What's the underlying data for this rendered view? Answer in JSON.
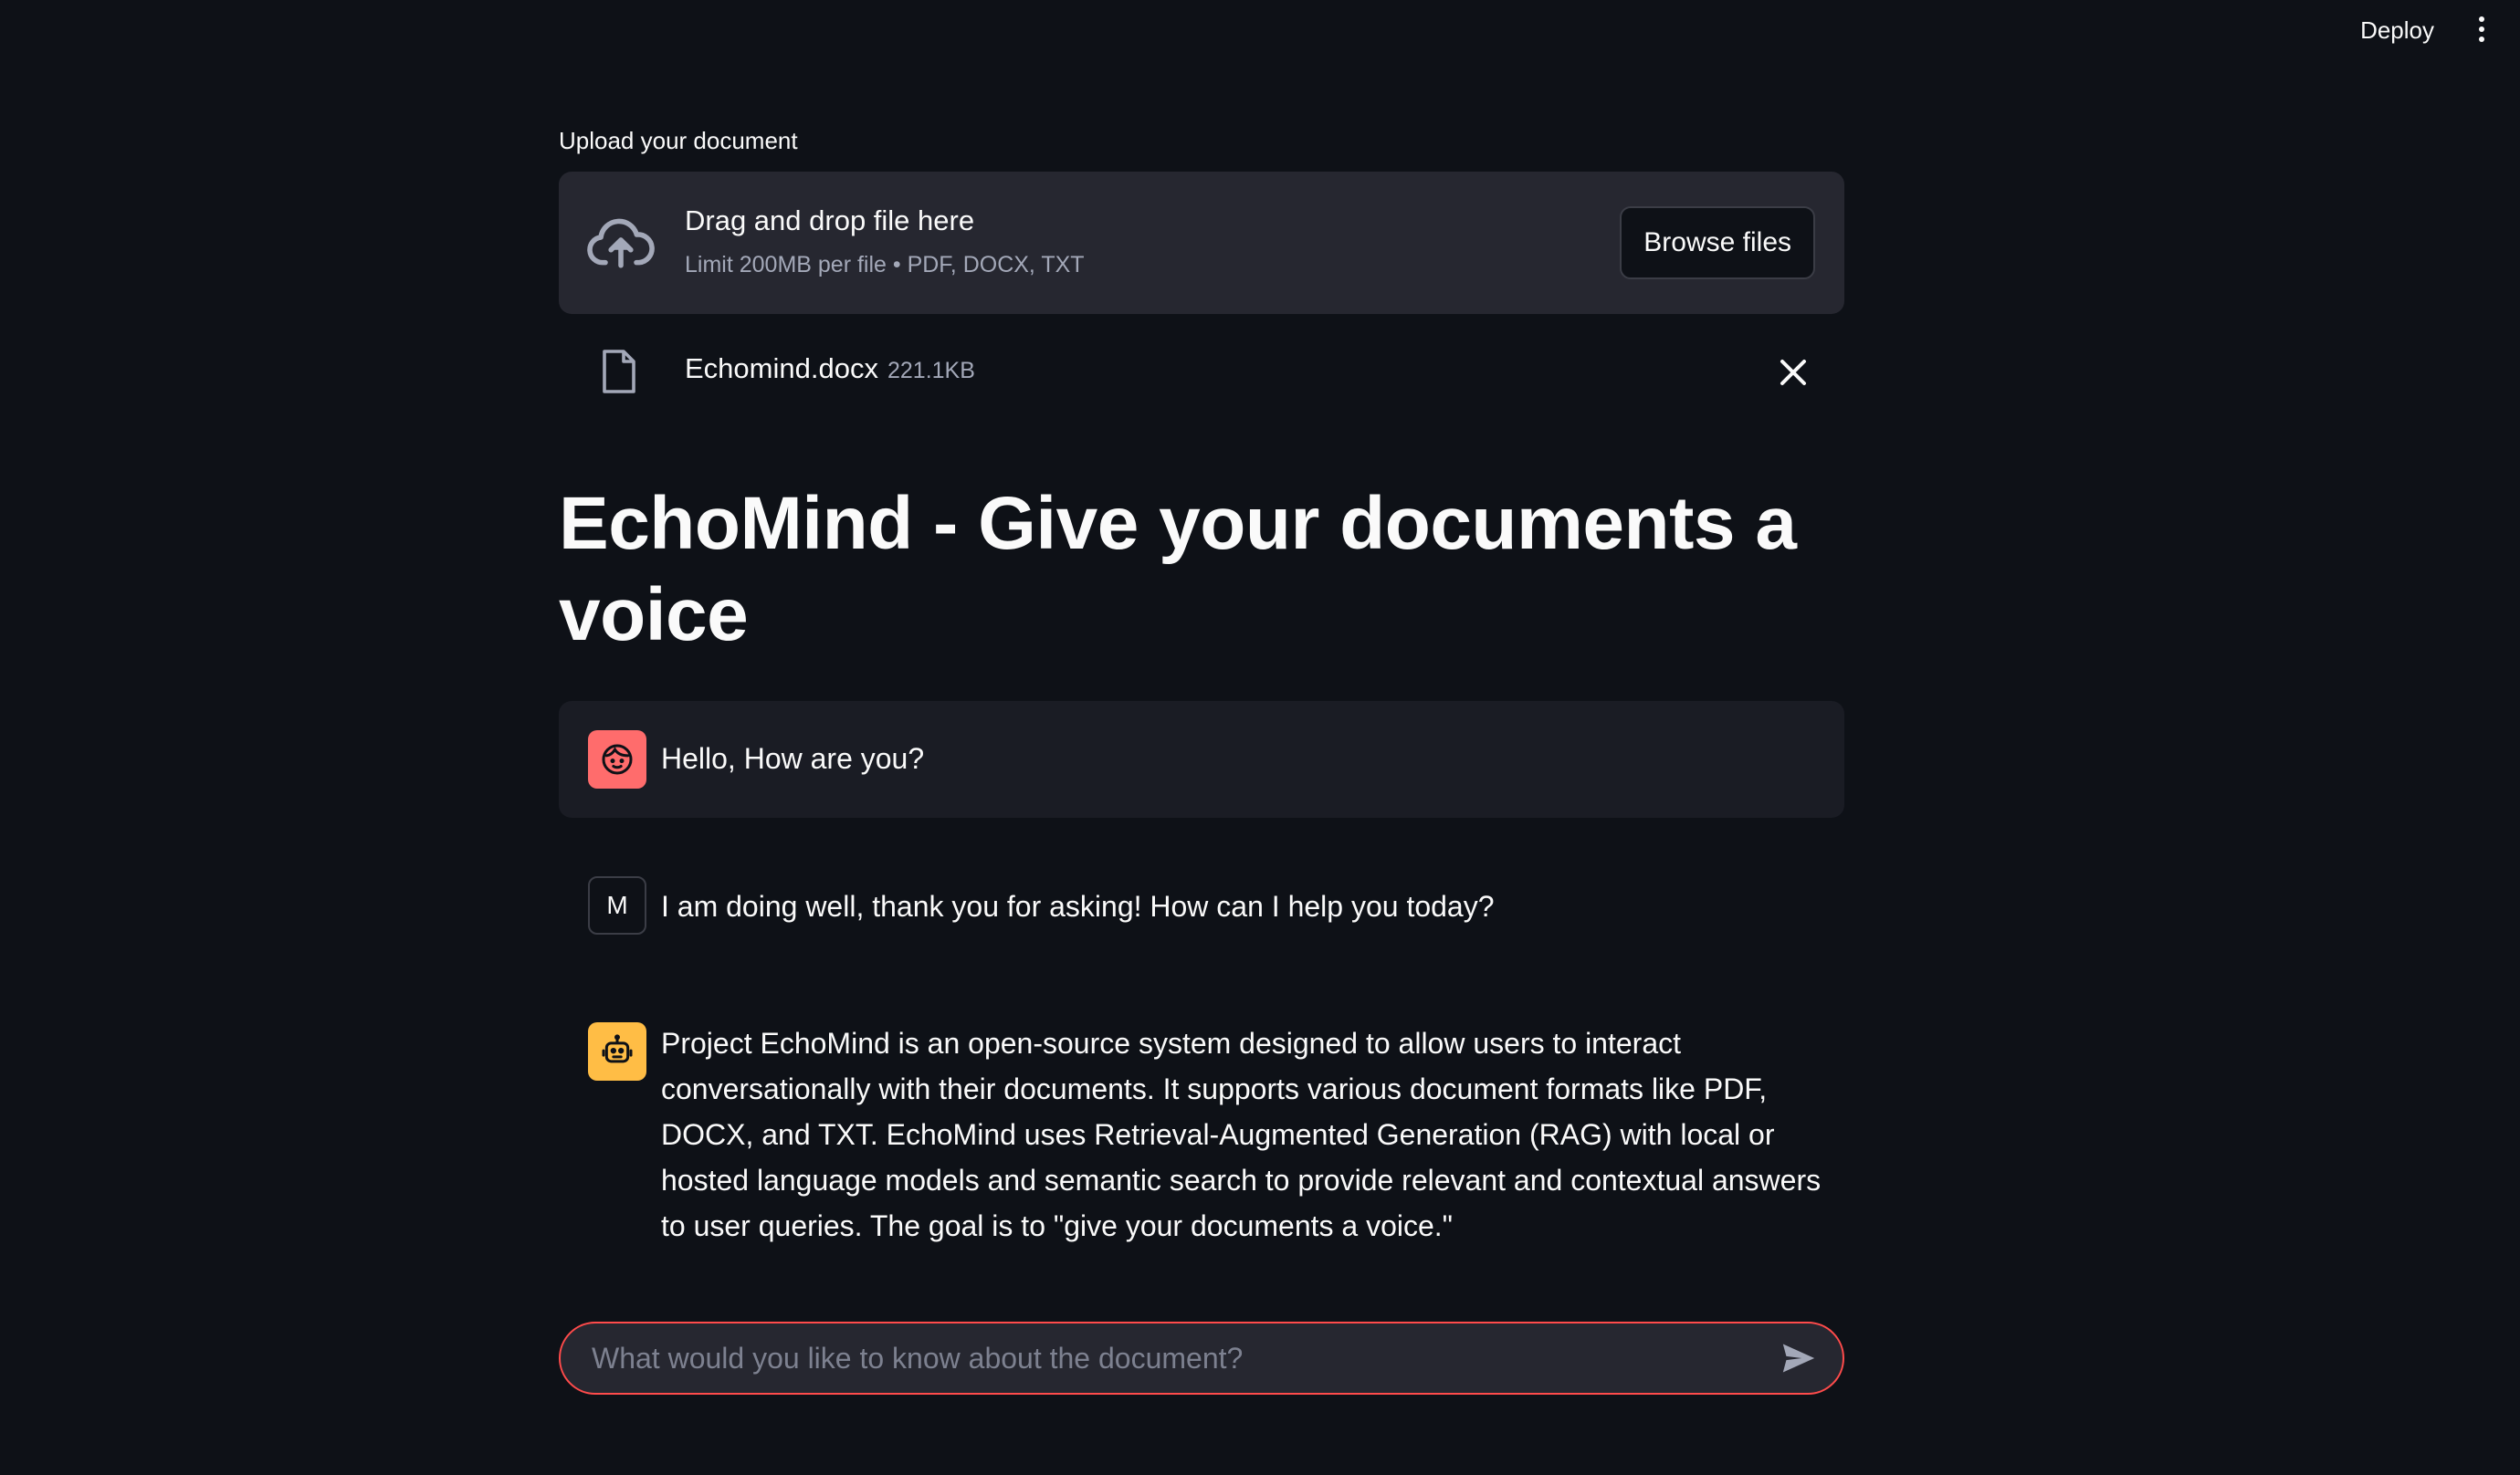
{
  "header": {
    "deploy_label": "Deploy",
    "menu_icon": "kebab-menu-icon"
  },
  "uploader": {
    "label": "Upload your document",
    "drop_title": "Drag and drop file here",
    "drop_subtitle": "Limit 200MB per file • PDF, DOCX, TXT",
    "browse_label": "Browse files",
    "icon": "cloud-upload-icon"
  },
  "uploaded_file": {
    "name": "Echomind.docx",
    "size": "221.1KB",
    "icon": "file-icon",
    "remove_icon": "close-icon"
  },
  "page": {
    "title": "EchoMind - Give your documents a voice"
  },
  "messages": [
    {
      "role": "user",
      "avatar_icon": "face-icon",
      "text": "Hello, How are you?"
    },
    {
      "role": "assistant",
      "avatar_letter": "M",
      "text": "I am doing well, thank you for asking! How can I help you today?"
    },
    {
      "role": "assistant",
      "avatar_icon": "robot-icon",
      "text": "Project EchoMind is an open-source system designed to allow users to interact conversationally with their documents. It supports various document formats like PDF, DOCX, and TXT. EchoMind uses Retrieval-Augmented Generation (RAG) with local or hosted language models and semantic search to provide relevant and contextual answers to user queries. The goal is to \"give your documents a voice.\""
    }
  ],
  "chat_input": {
    "placeholder": "What would you like to know about the document?",
    "value": "",
    "send_icon": "send-icon"
  },
  "colors": {
    "background": "#0e1117",
    "surface": "#262730",
    "accent": "#ff4b4b",
    "user_avatar": "#ff6c6c",
    "bot_avatar": "#ffbd45"
  }
}
